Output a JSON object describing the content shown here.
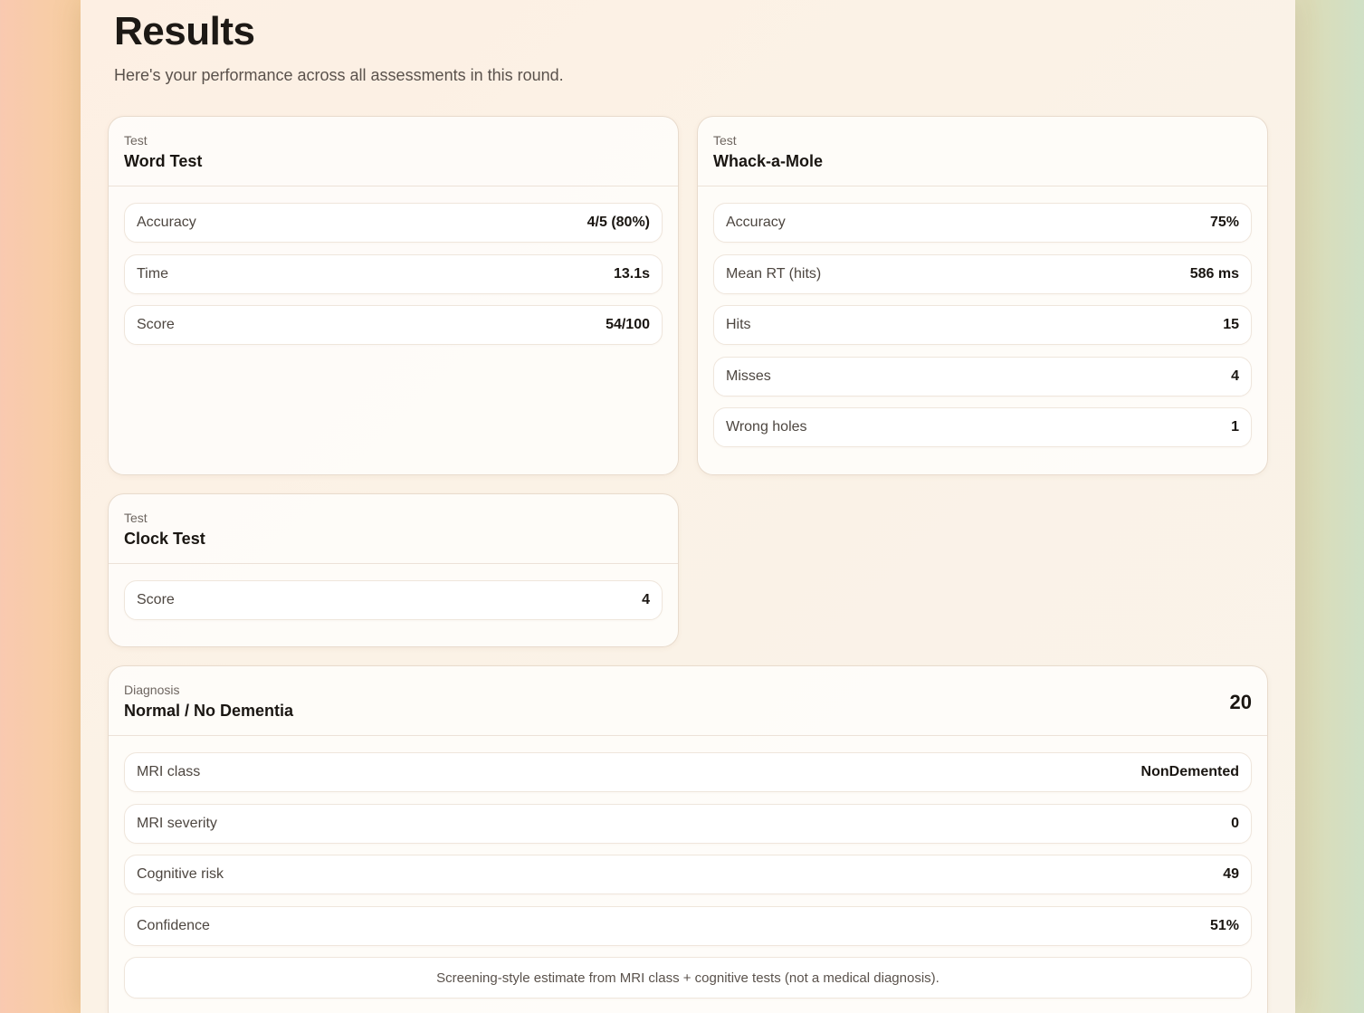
{
  "page": {
    "title": "Results",
    "subtitle": "Here's your performance across all assessments in this round."
  },
  "cards": {
    "word": {
      "kicker": "Test",
      "title": "Word Test",
      "rows": [
        {
          "label": "Accuracy",
          "value": "4/5 (80%)"
        },
        {
          "label": "Time",
          "value": "13.1s"
        },
        {
          "label": "Score",
          "value": "54/100"
        }
      ]
    },
    "mole": {
      "kicker": "Test",
      "title": "Whack-a-Mole",
      "rows": [
        {
          "label": "Accuracy",
          "value": "75%"
        },
        {
          "label": "Mean RT (hits)",
          "value": "586 ms"
        },
        {
          "label": "Hits",
          "value": "15"
        },
        {
          "label": "Misses",
          "value": "4"
        },
        {
          "label": "Wrong holes",
          "value": "1"
        }
      ]
    },
    "clock": {
      "kicker": "Test",
      "title": "Clock Test",
      "rows": [
        {
          "label": "Score",
          "value": "4"
        }
      ]
    },
    "diagnosis": {
      "kicker": "Diagnosis",
      "title": "Normal / No Dementia",
      "score": "20",
      "rows": [
        {
          "label": "MRI class",
          "value": "NonDemented"
        },
        {
          "label": "MRI severity",
          "value": "0"
        },
        {
          "label": "Cognitive risk",
          "value": "49"
        },
        {
          "label": "Confidence",
          "value": "51%"
        }
      ],
      "note": "Screening-style estimate from MRI class + cognitive tests (not a medical diagnosis)."
    }
  }
}
